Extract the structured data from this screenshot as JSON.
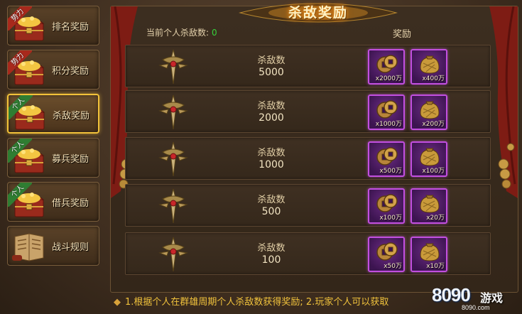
{
  "sidebar": {
    "items": [
      {
        "label": "排名奖励",
        "badge": "势力",
        "badge_color": "red",
        "icon": "treasure-chest-icon",
        "active": false
      },
      {
        "label": "积分奖励",
        "badge": "势力",
        "badge_color": "red",
        "icon": "treasure-chest-icon",
        "active": false
      },
      {
        "label": "杀敌奖励",
        "badge": "个人",
        "badge_color": "green",
        "icon": "treasure-chest-icon",
        "active": true
      },
      {
        "label": "募兵奖励",
        "badge": "个人",
        "badge_color": "green",
        "icon": "treasure-chest-icon",
        "active": false
      },
      {
        "label": "借兵奖励",
        "badge": "个人",
        "badge_color": "green",
        "icon": "treasure-chest-icon",
        "active": false
      },
      {
        "label": "战斗规则",
        "badge": "",
        "badge_color": "",
        "icon": "scroll-book-icon",
        "active": false
      }
    ]
  },
  "main": {
    "title": "杀敌奖励",
    "current_kills_label": "当前个人杀敌数:",
    "current_kills_value": "0",
    "reward_header": "奖励",
    "rows": [
      {
        "label": "杀敌数",
        "value": "5000",
        "rewards": [
          {
            "icon": "copper-coin-icon",
            "qty": "x2000万"
          },
          {
            "icon": "grain-sack-icon",
            "qty": "x400万"
          }
        ]
      },
      {
        "label": "杀敌数",
        "value": "2000",
        "rewards": [
          {
            "icon": "copper-coin-icon",
            "qty": "x1000万"
          },
          {
            "icon": "grain-sack-icon",
            "qty": "x200万"
          }
        ]
      },
      {
        "label": "杀敌数",
        "value": "1000",
        "rewards": [
          {
            "icon": "copper-coin-icon",
            "qty": "x500万"
          },
          {
            "icon": "grain-sack-icon",
            "qty": "x100万"
          }
        ]
      },
      {
        "label": "杀敌数",
        "value": "500",
        "rewards": [
          {
            "icon": "copper-coin-icon",
            "qty": "x100万"
          },
          {
            "icon": "grain-sack-icon",
            "qty": "x20万"
          }
        ]
      },
      {
        "label": "杀敌数",
        "value": "100",
        "rewards": [
          {
            "icon": "copper-coin-icon",
            "qty": "x50万"
          },
          {
            "icon": "grain-sack-icon",
            "qty": "x10万"
          }
        ]
      }
    ]
  },
  "footer": {
    "note": "1.根据个人在群雄周期个人杀敌数获得奖励; 2.玩家个人可以获取"
  },
  "watermark": {
    "number": "8090",
    "game": "游戏",
    "url": "8090.com"
  },
  "colors": {
    "active_border": "#f2c23a",
    "reward_border": "#c24fe0",
    "kills_value": "#36d33a",
    "footer_text": "#f0c23c"
  }
}
